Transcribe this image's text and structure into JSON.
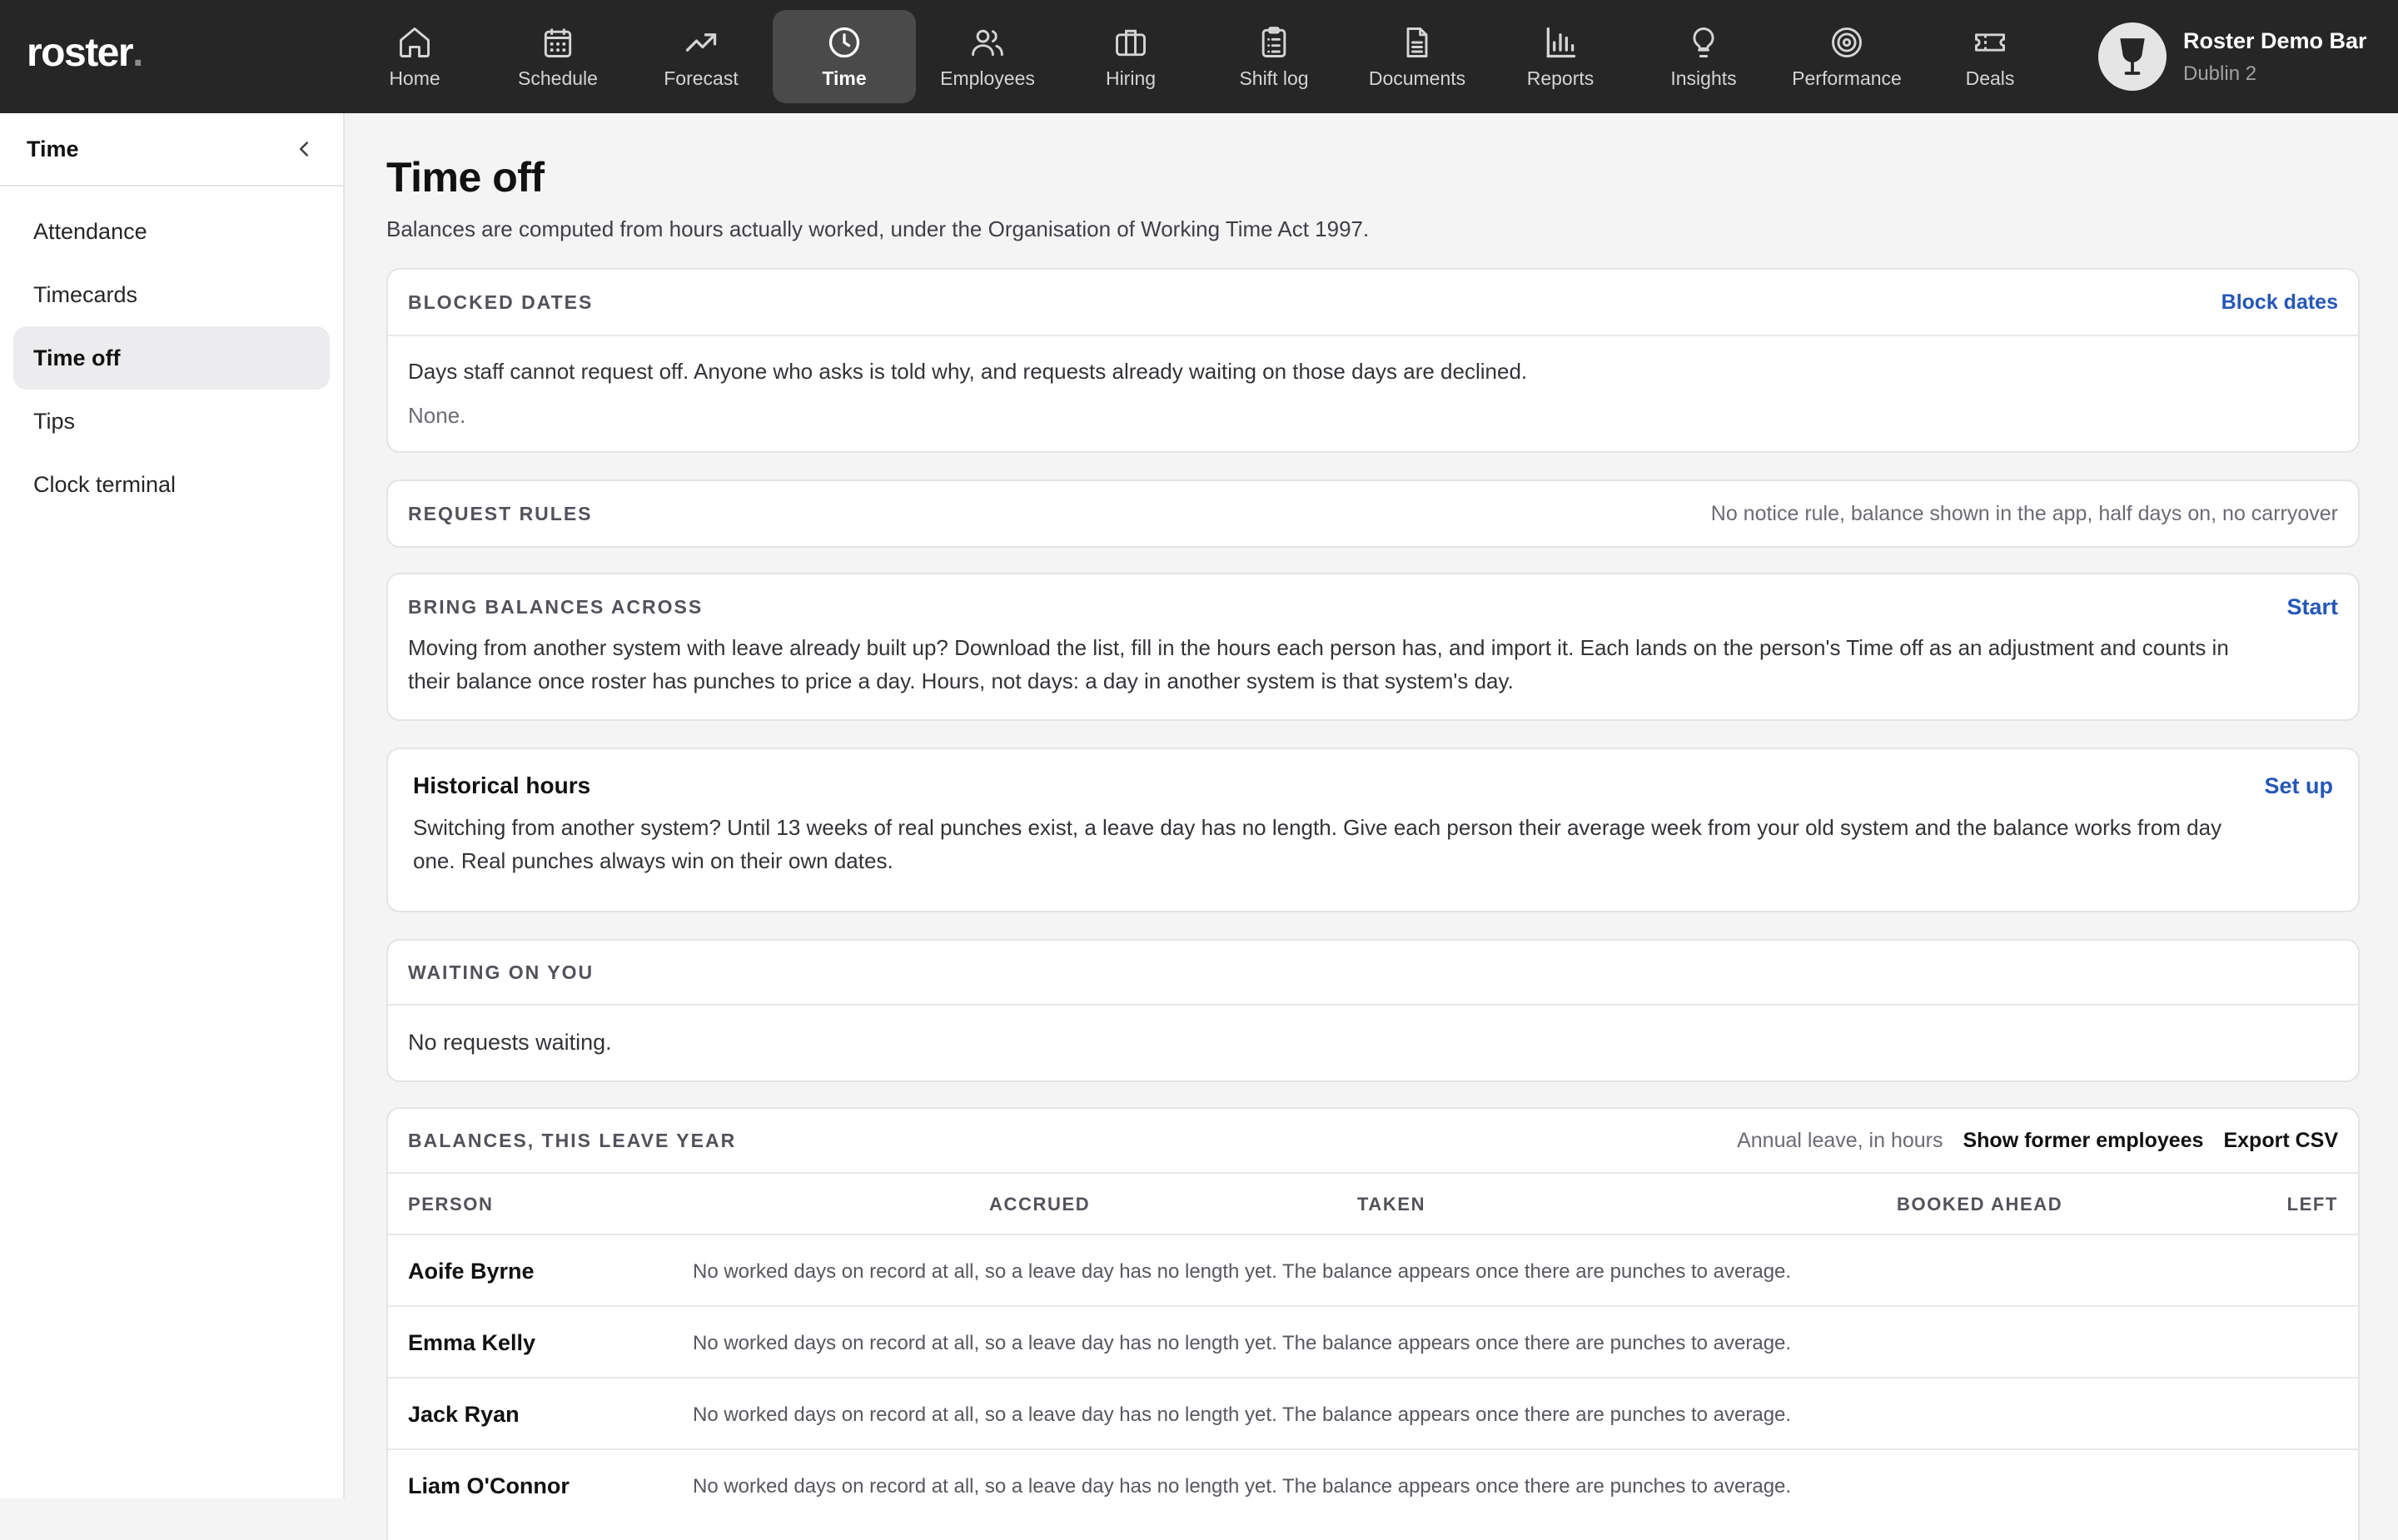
{
  "app": {
    "logo_text": "roster",
    "logo_dot": "."
  },
  "nav": [
    {
      "label": "Home",
      "icon": "home-icon"
    },
    {
      "label": "Schedule",
      "icon": "calendar-icon"
    },
    {
      "label": "Forecast",
      "icon": "trend-up-icon"
    },
    {
      "label": "Time",
      "icon": "clock-icon",
      "active": true
    },
    {
      "label": "Employees",
      "icon": "users-icon"
    },
    {
      "label": "Hiring",
      "icon": "briefcase-icon"
    },
    {
      "label": "Shift log",
      "icon": "clipboard-icon"
    },
    {
      "label": "Documents",
      "icon": "document-icon"
    },
    {
      "label": "Reports",
      "icon": "bar-chart-icon"
    },
    {
      "label": "Insights",
      "icon": "lightbulb-icon"
    },
    {
      "label": "Performance",
      "icon": "target-icon"
    },
    {
      "label": "Deals",
      "icon": "ticket-icon"
    }
  ],
  "account": {
    "name": "Roster Demo Bar",
    "location": "Dublin 2",
    "avatar_icon": "wine-glass-icon"
  },
  "sidebar": {
    "title": "Time",
    "items": [
      {
        "label": "Attendance"
      },
      {
        "label": "Timecards"
      },
      {
        "label": "Time off",
        "active": true
      },
      {
        "label": "Tips"
      },
      {
        "label": "Clock terminal"
      }
    ]
  },
  "page": {
    "title": "Time off",
    "subtitle": "Balances are computed from hours actually worked, under the Organisation of Working Time Act 1997."
  },
  "blocked_dates": {
    "title": "BLOCKED DATES",
    "action": "Block dates",
    "description": "Days staff cannot request off. Anyone who asks is told why, and requests already waiting on those days are declined.",
    "value": "None."
  },
  "request_rules": {
    "title": "REQUEST RULES",
    "summary": "No notice rule, balance shown in the app, half days on, no carryover"
  },
  "bring_balances": {
    "title": "BRING BALANCES ACROSS",
    "action": "Start",
    "description": "Moving from another system with leave already built up? Download the list, fill in the hours each person has, and import it. Each lands on the person's Time off as an adjustment and counts in their balance once roster has punches to price a day. Hours, not days: a day in another system is that system's day."
  },
  "historical_hours": {
    "title": "Historical hours",
    "action": "Set up",
    "description": "Switching from another system? Until 13 weeks of real punches exist, a leave day has no length. Give each person their average week from your old system and the balance works from day one. Real punches always win on their own dates."
  },
  "waiting": {
    "title": "WAITING ON YOU",
    "value": "No requests waiting."
  },
  "balances": {
    "title": "BALANCES, THIS LEAVE YEAR",
    "unit_note": "Annual leave, in hours",
    "show_former": "Show former employees",
    "export": "Export CSV",
    "columns": [
      "PERSON",
      "ACCRUED",
      "TAKEN",
      "BOOKED AHEAD",
      "LEFT"
    ],
    "rows": [
      {
        "name": "Aoife Byrne",
        "note": "No worked days on record at all, so a leave day has no length yet. The balance appears once there are punches to average."
      },
      {
        "name": "Emma Kelly",
        "note": "No worked days on record at all, so a leave day has no length yet. The balance appears once there are punches to average."
      },
      {
        "name": "Jack Ryan",
        "note": "No worked days on record at all, so a leave day has no length yet. The balance appears once there are punches to average."
      },
      {
        "name": "Liam O'Connor",
        "note": "No worked days on record at all, so a leave day has no length yet. The balance appears once there are punches to average."
      }
    ]
  },
  "colors": {
    "topbar": "#262626",
    "active_nav": "#4a4a4a",
    "link": "#2557b8",
    "page_bg": "#f4f4f5"
  }
}
